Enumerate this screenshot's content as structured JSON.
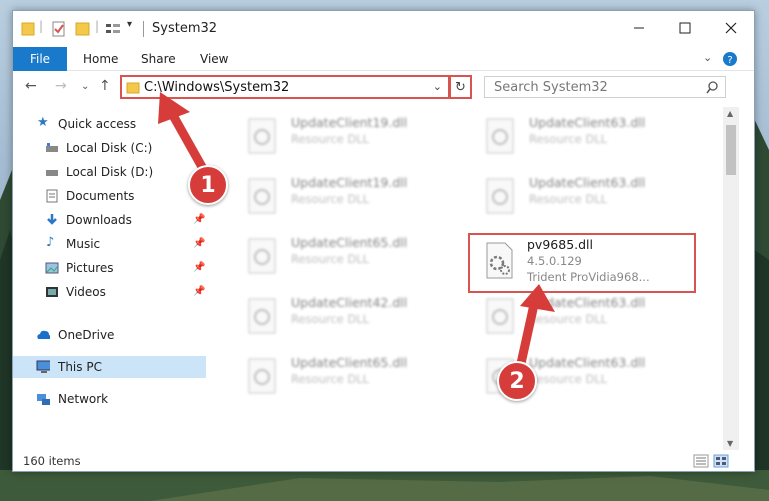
{
  "window": {
    "title": "System32"
  },
  "ribbon": {
    "file_tab": "File",
    "tabs": [
      "Home",
      "Share",
      "View"
    ]
  },
  "address": {
    "path": "C:\\Windows\\System32"
  },
  "search": {
    "placeholder": "Search System32"
  },
  "sidebar": {
    "items": [
      {
        "label": "Quick access",
        "icon": "star-icon"
      },
      {
        "label": "Local Disk (C:)",
        "icon": "drive-icon"
      },
      {
        "label": "Local Disk (D:)",
        "icon": "drive-icon"
      },
      {
        "label": "Documents",
        "icon": "documents-icon"
      },
      {
        "label": "Downloads",
        "icon": "download-icon"
      },
      {
        "label": "Music",
        "icon": "music-icon"
      },
      {
        "label": "Pictures",
        "icon": "pictures-icon"
      },
      {
        "label": "Videos",
        "icon": "videos-icon"
      },
      {
        "label": "OneDrive",
        "icon": "cloud-icon"
      },
      {
        "label": "This PC",
        "icon": "computer-icon"
      },
      {
        "label": "Network",
        "icon": "network-icon"
      }
    ]
  },
  "files": [
    {
      "name": "UpdateClient19.dll",
      "type": "Resource DLL"
    },
    {
      "name": "UpdateClient63.dll",
      "type": "Resource DLL"
    },
    {
      "name": "UpdateClient19.dll",
      "type": "Resource DLL"
    },
    {
      "name": "UpdateClient63.dll",
      "type": "Resource DLL"
    },
    {
      "name": "UpdateClient65.dll",
      "type": "Resource DLL"
    },
    {
      "name": "pv9685.dll",
      "version": "4.5.0.129",
      "description": "Trident ProVidia968..."
    },
    {
      "name": "UpdateClient42.dll",
      "type": "Resource DLL"
    },
    {
      "name": "UpdateClient63.dll",
      "type": "Resource DLL"
    },
    {
      "name": "UpdateClient65.dll",
      "type": "Resource DLL"
    },
    {
      "name": "UpdateClient63.dll",
      "type": "Resource DLL"
    }
  ],
  "status": {
    "item_count": "160 items"
  },
  "badges": [
    "1",
    "2"
  ],
  "colors": {
    "accent": "#1979ca",
    "annotation": "#d63d3a",
    "selection": "#cce4f7"
  }
}
